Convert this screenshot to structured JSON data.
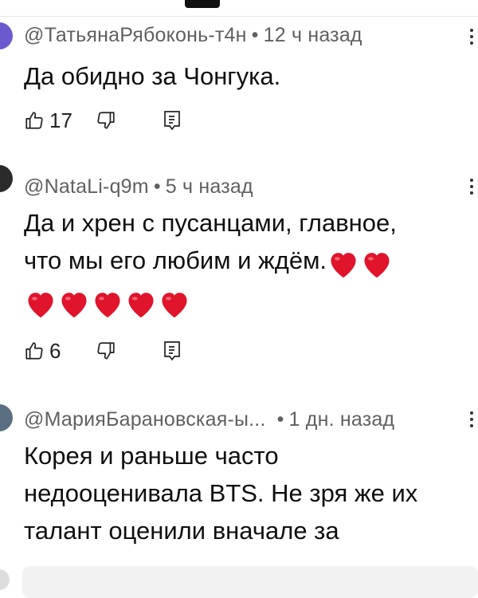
{
  "comments": [
    {
      "author": "@ТатьянаРябоконь-т4н",
      "separator": "•",
      "time": "12 ч назад",
      "lines": [
        "Да обидно за Чонгука."
      ],
      "likes": "17",
      "avatar_color": "#6a5acd"
    },
    {
      "author": "@NataLi-q9m",
      "separator": "•",
      "time": "5 ч назад",
      "lines": [
        "Да и хрен с пусанцами, главное,",
        "что мы его любим и ждём."
      ],
      "likes": "6",
      "avatar_color": "#2b2b2b",
      "hearts_line1": 2,
      "hearts_line2": 5
    },
    {
      "author": "@МарияБарановская-ы...",
      "separator": "•",
      "time": "1 дн. назад",
      "lines": [
        "Корея и раньше часто",
        "недооценивала BTS. Не зря же их",
        "талант оценили вначале за"
      ],
      "avatar_color": "#5a7080"
    }
  ],
  "icons": {
    "like": "thumbs-up-icon",
    "dislike": "thumbs-down-icon",
    "reply": "reply-icon",
    "more": "more-vert-icon",
    "heart": "heart-emoji"
  },
  "colors": {
    "heart": "#e0142b",
    "meta": "#606060",
    "text": "#0f0f0f"
  }
}
